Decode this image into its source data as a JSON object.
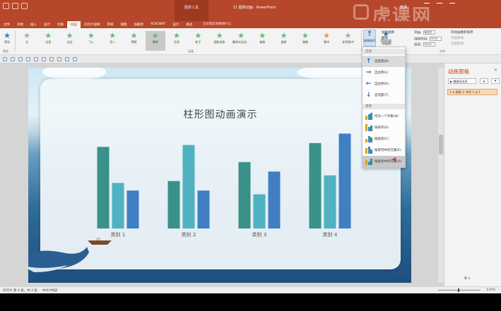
{
  "window": {
    "title": "11 图表动画 - PowerPoint",
    "context_tab_group": "图表工具",
    "sign_in": "登录"
  },
  "watermark": "虎课网",
  "tabs": [
    "文件",
    "开始",
    "插入",
    "设计",
    "切换",
    "动画",
    "幻灯片放映",
    "审阅",
    "视图",
    "加载项",
    "ACROBAT",
    "设计",
    "格式"
  ],
  "active_tab": "动画",
  "tell_me": "告诉我您想要做什么",
  "ribbon": {
    "preview_label": "预览",
    "preview_group": "预览",
    "animation_group": "动画",
    "timing_group": "计时",
    "animations": [
      {
        "label": "无",
        "color": "gray"
      },
      {
        "label": "出现",
        "color": "green"
      },
      {
        "label": "淡出",
        "color": "green"
      },
      {
        "label": "飞入",
        "color": "green"
      },
      {
        "label": "浮入",
        "color": "green"
      },
      {
        "label": "劈裂",
        "color": "green"
      },
      {
        "label": "擦除",
        "color": "green",
        "selected": true
      },
      {
        "label": "形状",
        "color": "green"
      },
      {
        "label": "轮子",
        "color": "green"
      },
      {
        "label": "随机线条",
        "color": "green"
      },
      {
        "label": "翻转式由远...",
        "color": "green"
      },
      {
        "label": "缩放",
        "color": "green"
      },
      {
        "label": "旋转",
        "color": "green"
      },
      {
        "label": "弹跳",
        "color": "green"
      },
      {
        "label": "脉冲",
        "color": "gold"
      },
      {
        "label": "彩色脉冲",
        "color": "gray"
      }
    ],
    "effect_options": "效果选项",
    "add_animation": "添加动画",
    "animation_pane": "动画窗格",
    "trigger": "触发",
    "animation_painter": "动画刷",
    "start_label": "开始:",
    "start_value": "单击时",
    "duration_label": "持续时间:",
    "duration_value": "00.50",
    "delay_label": "延迟:",
    "delay_value": "00.00",
    "reorder_title": "对动画重新排序",
    "move_earlier": "向前移动",
    "move_later": "向后移动"
  },
  "dropdown": {
    "direction_header": "方向",
    "directions": [
      {
        "label": "自底部(B)",
        "icon": "arrow-up-icon",
        "glyph": "↑",
        "selected": true
      },
      {
        "label": "自左侧(L)",
        "icon": "arrow-right-icon",
        "glyph": "→"
      },
      {
        "label": "自右侧(R)",
        "icon": "arrow-left-icon",
        "glyph": "←"
      },
      {
        "label": "自顶部(T)",
        "icon": "arrow-down-icon",
        "glyph": "↓"
      }
    ],
    "sequence_header": "序列",
    "sequences": [
      {
        "label": "作为一个对象(N)"
      },
      {
        "label": "按系列(S)"
      },
      {
        "label": "按类别(C)"
      },
      {
        "label": "按系列中的元素(E)"
      },
      {
        "label": "按类别中的元素(A)",
        "hover": true
      }
    ]
  },
  "slide": {
    "chart_title": "柱形图动画演示"
  },
  "chart_data": {
    "type": "bar",
    "title": "柱形图动画演示",
    "categories": [
      "类别 1",
      "类别 2",
      "类别 3",
      "类别 4"
    ],
    "series": [
      {
        "color": "#3a9189",
        "values": [
          4.3,
          2.5,
          3.5,
          4.5
        ]
      },
      {
        "color": "#4eb2c0",
        "values": [
          2.4,
          4.4,
          1.8,
          2.8
        ]
      },
      {
        "color": "#3f7fc2",
        "values": [
          2.0,
          2.0,
          3.0,
          5.0
        ]
      }
    ],
    "ylim": [
      0,
      5.5
    ],
    "grid": false,
    "legend": "none"
  },
  "anim_pane": {
    "title": "动画窗格",
    "play_label": "播放所选项",
    "item_label": "1 ★ 图表 3: 系列 1 点 1",
    "seconds_label": "秒 ▾"
  },
  "statusbar": {
    "slide_info": "幻灯片 第 4 张，共 4 张",
    "language": "中文(中国)",
    "zoom": "115%"
  }
}
